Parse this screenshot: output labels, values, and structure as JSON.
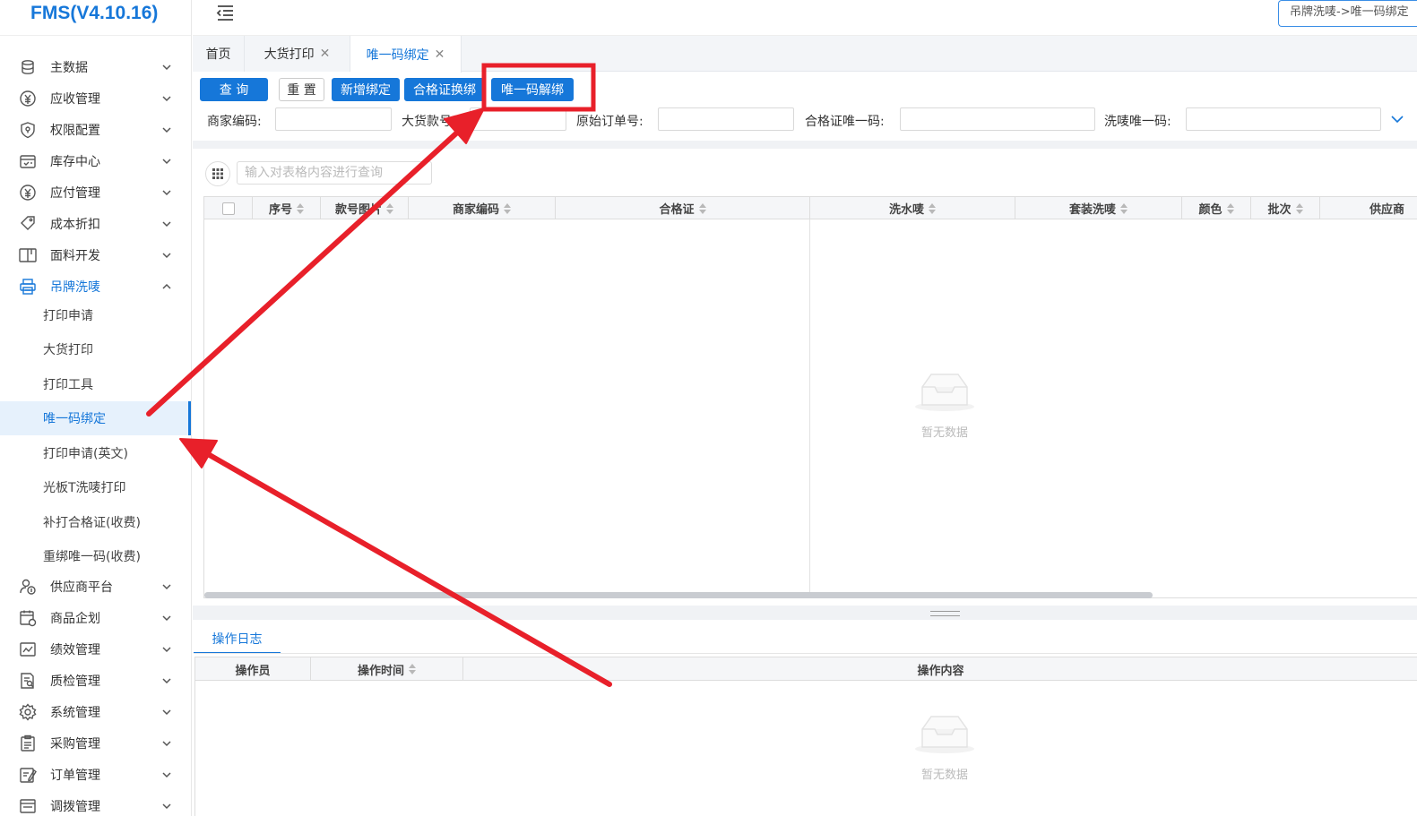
{
  "app": {
    "title": "FMS(V4.10.16)"
  },
  "breadcrumb": "吊牌洗唛->唯一码绑定",
  "colors": {
    "accent": "#1677d9",
    "annotation": "#e8202a"
  },
  "sidebar": {
    "items": [
      {
        "label": "主数据",
        "icon": "database-icon"
      },
      {
        "label": "应收管理",
        "icon": "yen-circle-icon"
      },
      {
        "label": "权限配置",
        "icon": "shield-icon"
      },
      {
        "label": "库存中心",
        "icon": "calendar-icon"
      },
      {
        "label": "应付管理",
        "icon": "yen-circle-icon"
      },
      {
        "label": "成本折扣",
        "icon": "tag-icon"
      },
      {
        "label": "面料开发",
        "icon": "book-icon"
      },
      {
        "label": "吊牌洗唛",
        "icon": "printer-icon",
        "expanded": true
      },
      {
        "label": "供应商平台",
        "icon": "user-coin-icon"
      },
      {
        "label": "商品企划",
        "icon": "calendar-plan-icon"
      },
      {
        "label": "绩效管理",
        "icon": "chart-icon"
      },
      {
        "label": "质检管理",
        "icon": "document-search-icon"
      },
      {
        "label": "系统管理",
        "icon": "gear-icon"
      },
      {
        "label": "采购管理",
        "icon": "clipboard-icon"
      },
      {
        "label": "订单管理",
        "icon": "edit-icon"
      },
      {
        "label": "调拨管理",
        "icon": "transfer-icon"
      }
    ],
    "subitems": [
      {
        "label": "打印申请"
      },
      {
        "label": "大货打印"
      },
      {
        "label": "打印工具"
      },
      {
        "label": "唯一码绑定",
        "active": true
      },
      {
        "label": "打印申请(英文)"
      },
      {
        "label": "光板T洗唛打印"
      },
      {
        "label": "补打合格证(收费)"
      },
      {
        "label": "重绑唯一码(收费)"
      }
    ]
  },
  "tabs": [
    {
      "label": "首页",
      "closable": false
    },
    {
      "label": "大货打印",
      "closable": true
    },
    {
      "label": "唯一码绑定",
      "closable": true,
      "active": true
    }
  ],
  "toolbar": {
    "query": "查 询",
    "reset": "重 置",
    "add_bind": "新增绑定",
    "cert_rebind": "合格证换绑",
    "unbind": "唯一码解绑"
  },
  "filters": {
    "merchant_code": "商家编码:",
    "bulk_style_no": "大货款号:",
    "original_order_no": "原始订单号:",
    "cert_unique_code": "合格证唯一码:",
    "wash_label_unique_code": "洗唛唯一码:"
  },
  "table": {
    "search_placeholder": "输入对表格内容进行查询",
    "columns": [
      "序号",
      "款号图片",
      "商家编码",
      "合格证",
      "洗水唛",
      "套装洗唛",
      "颜色",
      "批次",
      "供应商"
    ],
    "empty_text": "暂无数据"
  },
  "log": {
    "tab_label": "操作日志",
    "columns": [
      "操作员",
      "操作时间",
      "操作内容"
    ],
    "empty_text": "暂无数据"
  }
}
